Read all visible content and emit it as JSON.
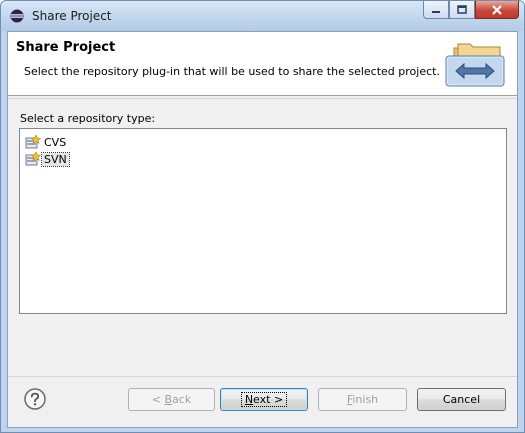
{
  "window": {
    "title": "Share Project"
  },
  "header": {
    "title": "Share Project",
    "description": "Select the repository plug-in that will be used to share the selected project."
  },
  "repository": {
    "label": "Select a repository type:",
    "items": [
      {
        "label": "CVS",
        "icon": "cvs-repo-icon",
        "selected": false
      },
      {
        "label": "SVN",
        "icon": "svn-repo-icon",
        "selected": true
      }
    ]
  },
  "buttons": {
    "back_prefix": "< ",
    "back_mnemonic": "B",
    "back_rest": "ack",
    "next_mnemonic": "N",
    "next_rest": "ext >",
    "finish_mnemonic": "F",
    "finish_rest": "inish",
    "cancel": "Cancel"
  },
  "icons": {
    "help": "help-icon",
    "header": "share-arrows-icon"
  }
}
